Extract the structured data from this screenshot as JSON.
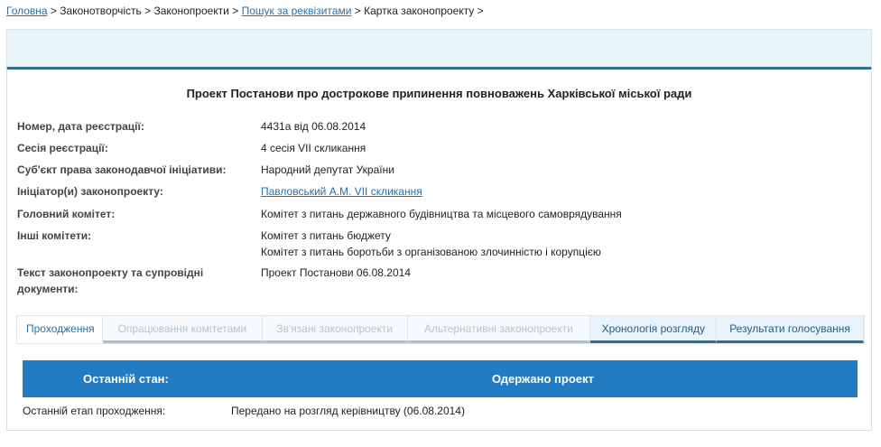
{
  "breadcrumb": [
    {
      "label": "Головна",
      "link": true
    },
    {
      "label": "Законотворчість",
      "link": false
    },
    {
      "label": "Законопроекти",
      "link": false
    },
    {
      "label": "Пошук за реквізитами",
      "link": true
    },
    {
      "label": "Картка законопроекту",
      "link": false
    }
  ],
  "title": "Проект Постанови про дострокове припинення повноважень Харківської міської ради",
  "fields": [
    {
      "label": "Номер, дата реєстрації:",
      "values": [
        "4431а від 06.08.2014"
      ]
    },
    {
      "label": "Сесія реєстрації:",
      "values": [
        "4 сесія VII скликання"
      ]
    },
    {
      "label": "Суб'єкт права законодавчої ініціативи:",
      "values": [
        "Народний депутат України"
      ]
    },
    {
      "label": "Ініціатор(и) законопроекту:",
      "values": [
        "Павловський А.М. VII скликання"
      ],
      "link": true
    },
    {
      "label": "Головний комітет:",
      "values": [
        "Комітет з питань державного будівництва та місцевого самоврядування"
      ]
    },
    {
      "label": "Інші комітети:",
      "values": [
        "Комітет з питань бюджету",
        "Комітет з питань боротьби з організованою злочинністю і корупцією"
      ]
    },
    {
      "label": "Текст законопроекту та супровідні документи:",
      "values": [
        "Проект Постанови 06.08.2014"
      ]
    }
  ],
  "tabs": [
    {
      "label": "Проходження",
      "state": "active"
    },
    {
      "label": "Опрацювання комітетами",
      "state": "disabled"
    },
    {
      "label": "Зв'язані законопроекти",
      "state": "disabled"
    },
    {
      "label": "Альтернативні законопроекти",
      "state": "disabled"
    },
    {
      "label": "Хронологія розгляду",
      "state": "dark"
    },
    {
      "label": "Результати голосування",
      "state": "dark"
    }
  ],
  "status": {
    "label": "Останній стан:",
    "value": "Одержано проект"
  },
  "last_stage": {
    "label": "Останній етап проходження:",
    "value": "Передано на розгляд керівництву (06.08.2014)"
  },
  "colors": {
    "accent": "#237bc2",
    "link": "#2a6fa8",
    "banner": "#e8f4fc"
  }
}
